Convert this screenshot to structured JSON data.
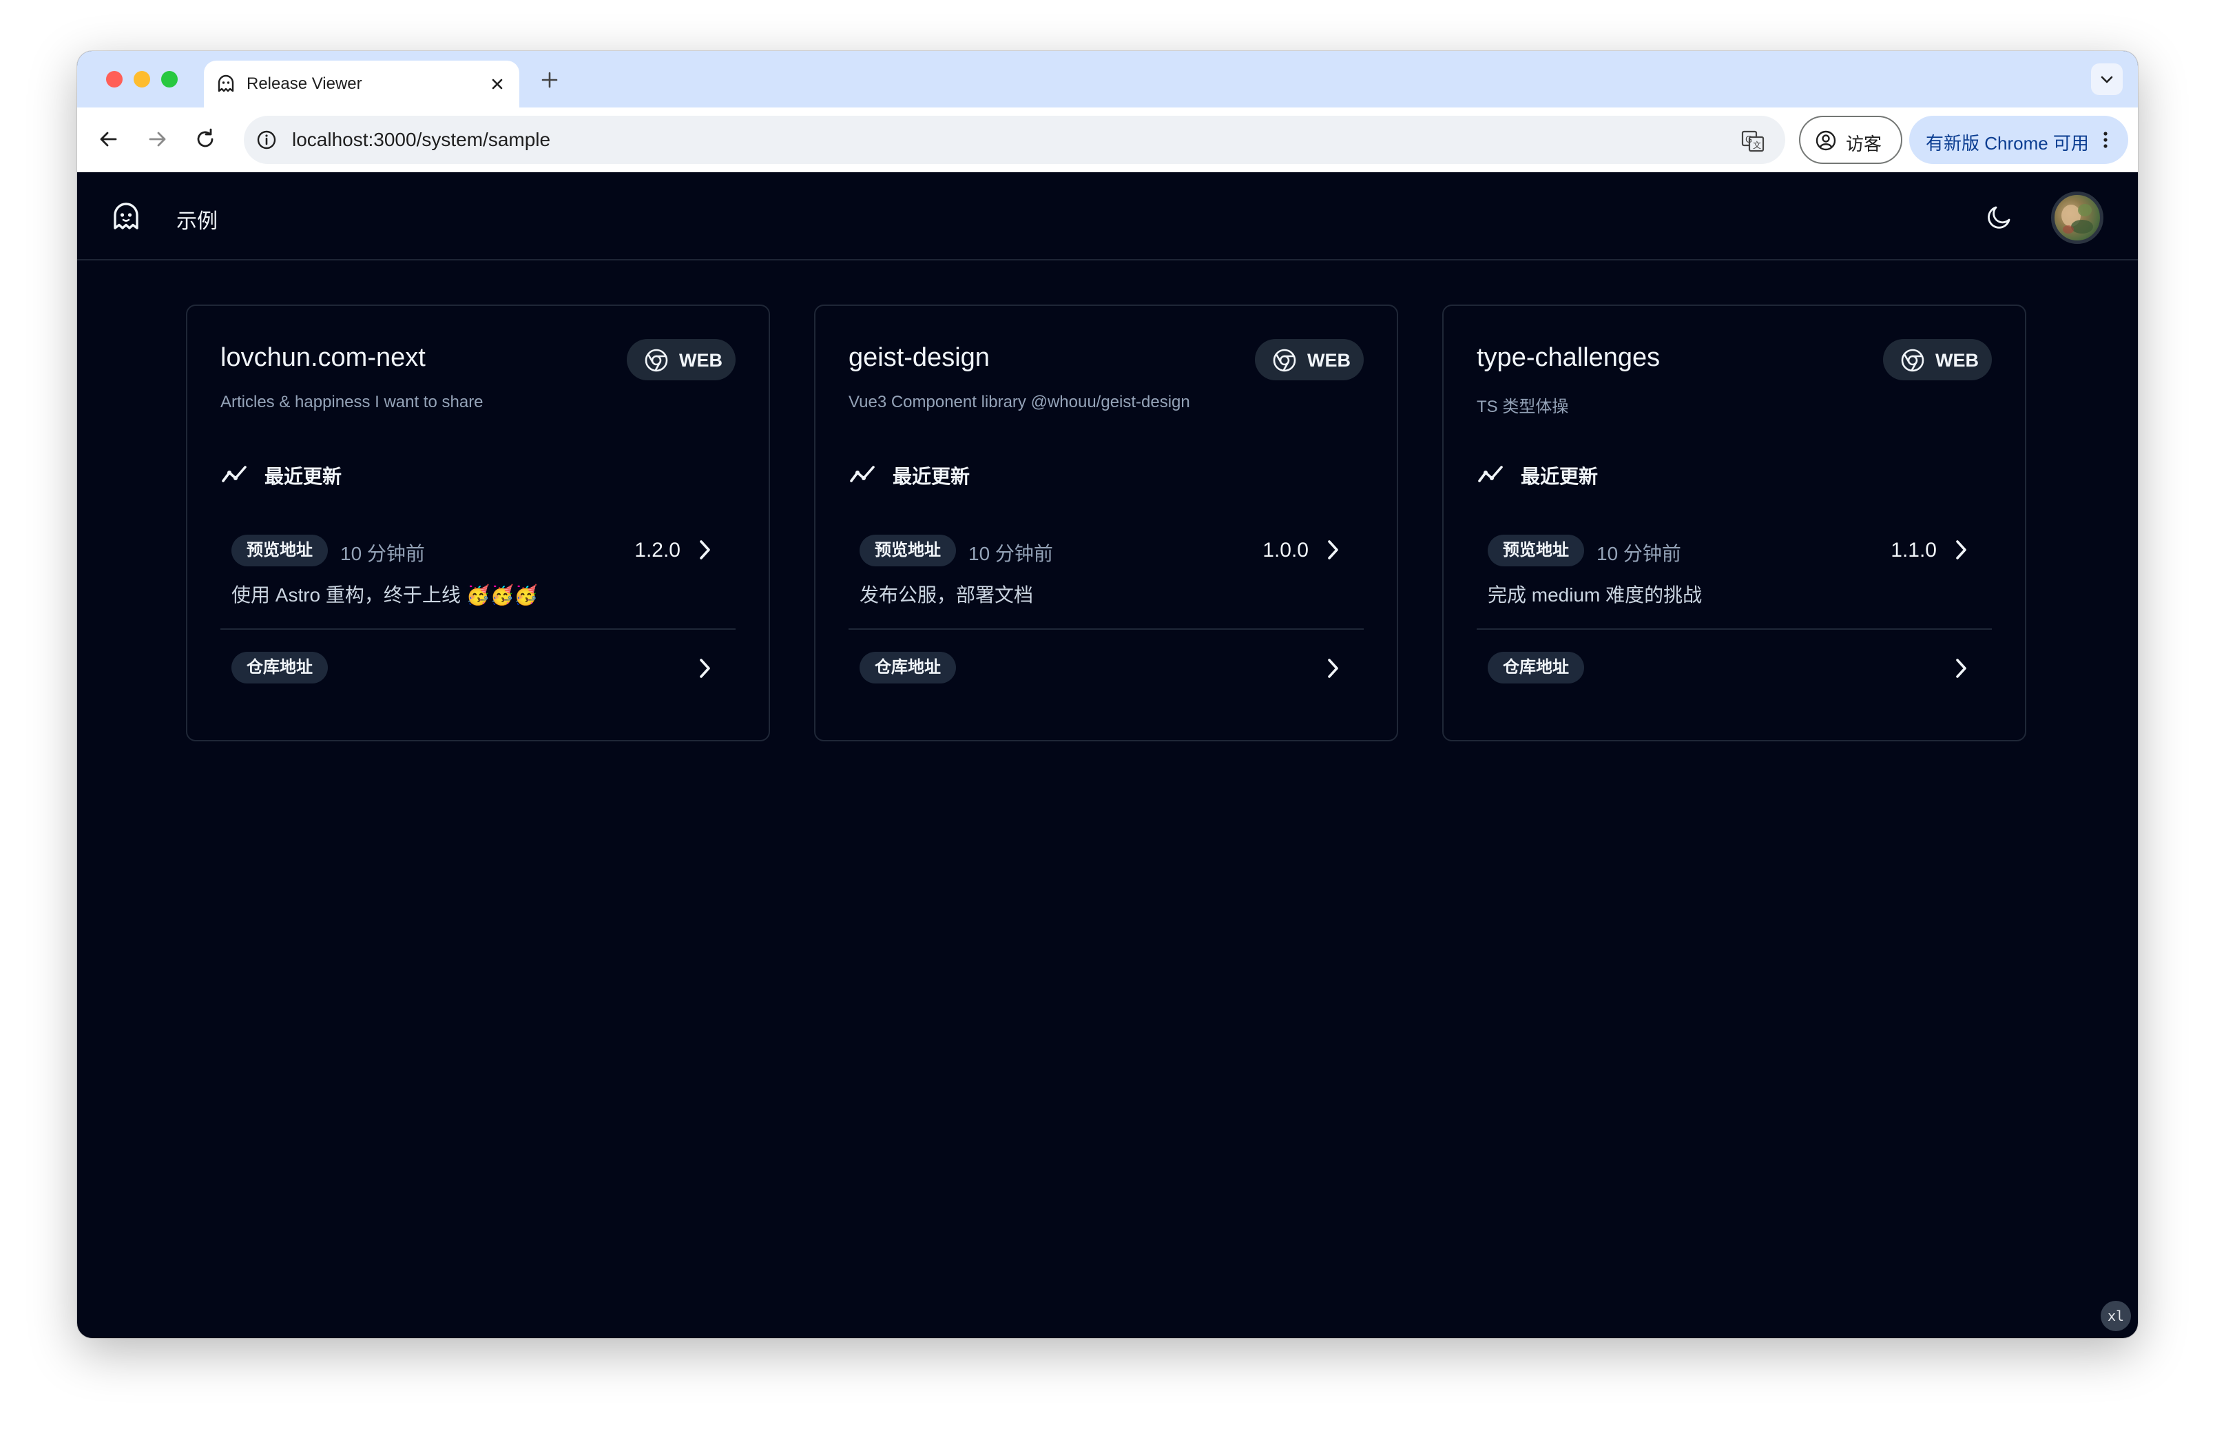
{
  "browser": {
    "tab_title": "Release Viewer",
    "url": "localhost:3000/system/sample",
    "guest_label": "访客",
    "update_label": "有新版 Chrome 可用"
  },
  "app": {
    "title": "示例"
  },
  "projects": [
    {
      "name": "lovchun.com-next",
      "description": "Articles & happiness I want to share",
      "platform": "WEB",
      "recent_label": "最近更新",
      "preview_label": "预览地址",
      "time": "10 分钟前",
      "version": "1.2.0",
      "message": "使用 Astro 重构，终于上线 🥳🥳🥳",
      "repo_label": "仓库地址"
    },
    {
      "name": "geist-design",
      "description": "Vue3 Component library @whouu/geist-design",
      "platform": "WEB",
      "recent_label": "最近更新",
      "preview_label": "预览地址",
      "time": "10 分钟前",
      "version": "1.0.0",
      "message": "发布公服，部署文档",
      "repo_label": "仓库地址"
    },
    {
      "name": "type-challenges",
      "description": "TS 类型体操",
      "platform": "WEB",
      "recent_label": "最近更新",
      "preview_label": "预览地址",
      "time": "10 分钟前",
      "version": "1.1.0",
      "message": "完成 medium 难度的挑战",
      "repo_label": "仓库地址"
    }
  ],
  "breakpoint_badge": "xl",
  "colors": {
    "page_bg": "#020617",
    "card_border": "#1f2737",
    "pill_bg": "#1e293b",
    "muted_text": "#94a3b8",
    "tabstrip_bg": "#d3e3fd"
  }
}
